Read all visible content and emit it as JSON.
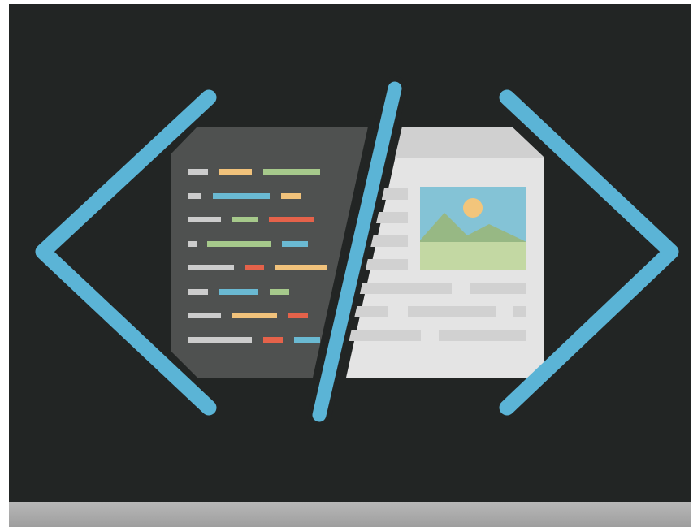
{
  "illustration": {
    "subject": "code-to-webpage-icon",
    "colors": {
      "background": "#222524",
      "bracket": "#5bb4d6",
      "code_sheet": "#4f5150",
      "page_sheet": "#e4e4e4",
      "page_header": "#cfcfcf",
      "image_sky": "#84c3d6",
      "image_sun": "#f2c57b",
      "image_mountain": "#97b884",
      "image_ground": "#c3d8a3",
      "code_gray": "#cccccc",
      "code_orange": "#f1c27b",
      "code_green": "#a6c98b",
      "code_blue": "#6ab9d2",
      "code_red": "#e5624a",
      "footer": "#a8a8a8"
    },
    "icons": [
      "left-angle-bracket",
      "slash",
      "right-angle-bracket",
      "code-sheet",
      "web-page-sheet",
      "picture"
    ]
  }
}
